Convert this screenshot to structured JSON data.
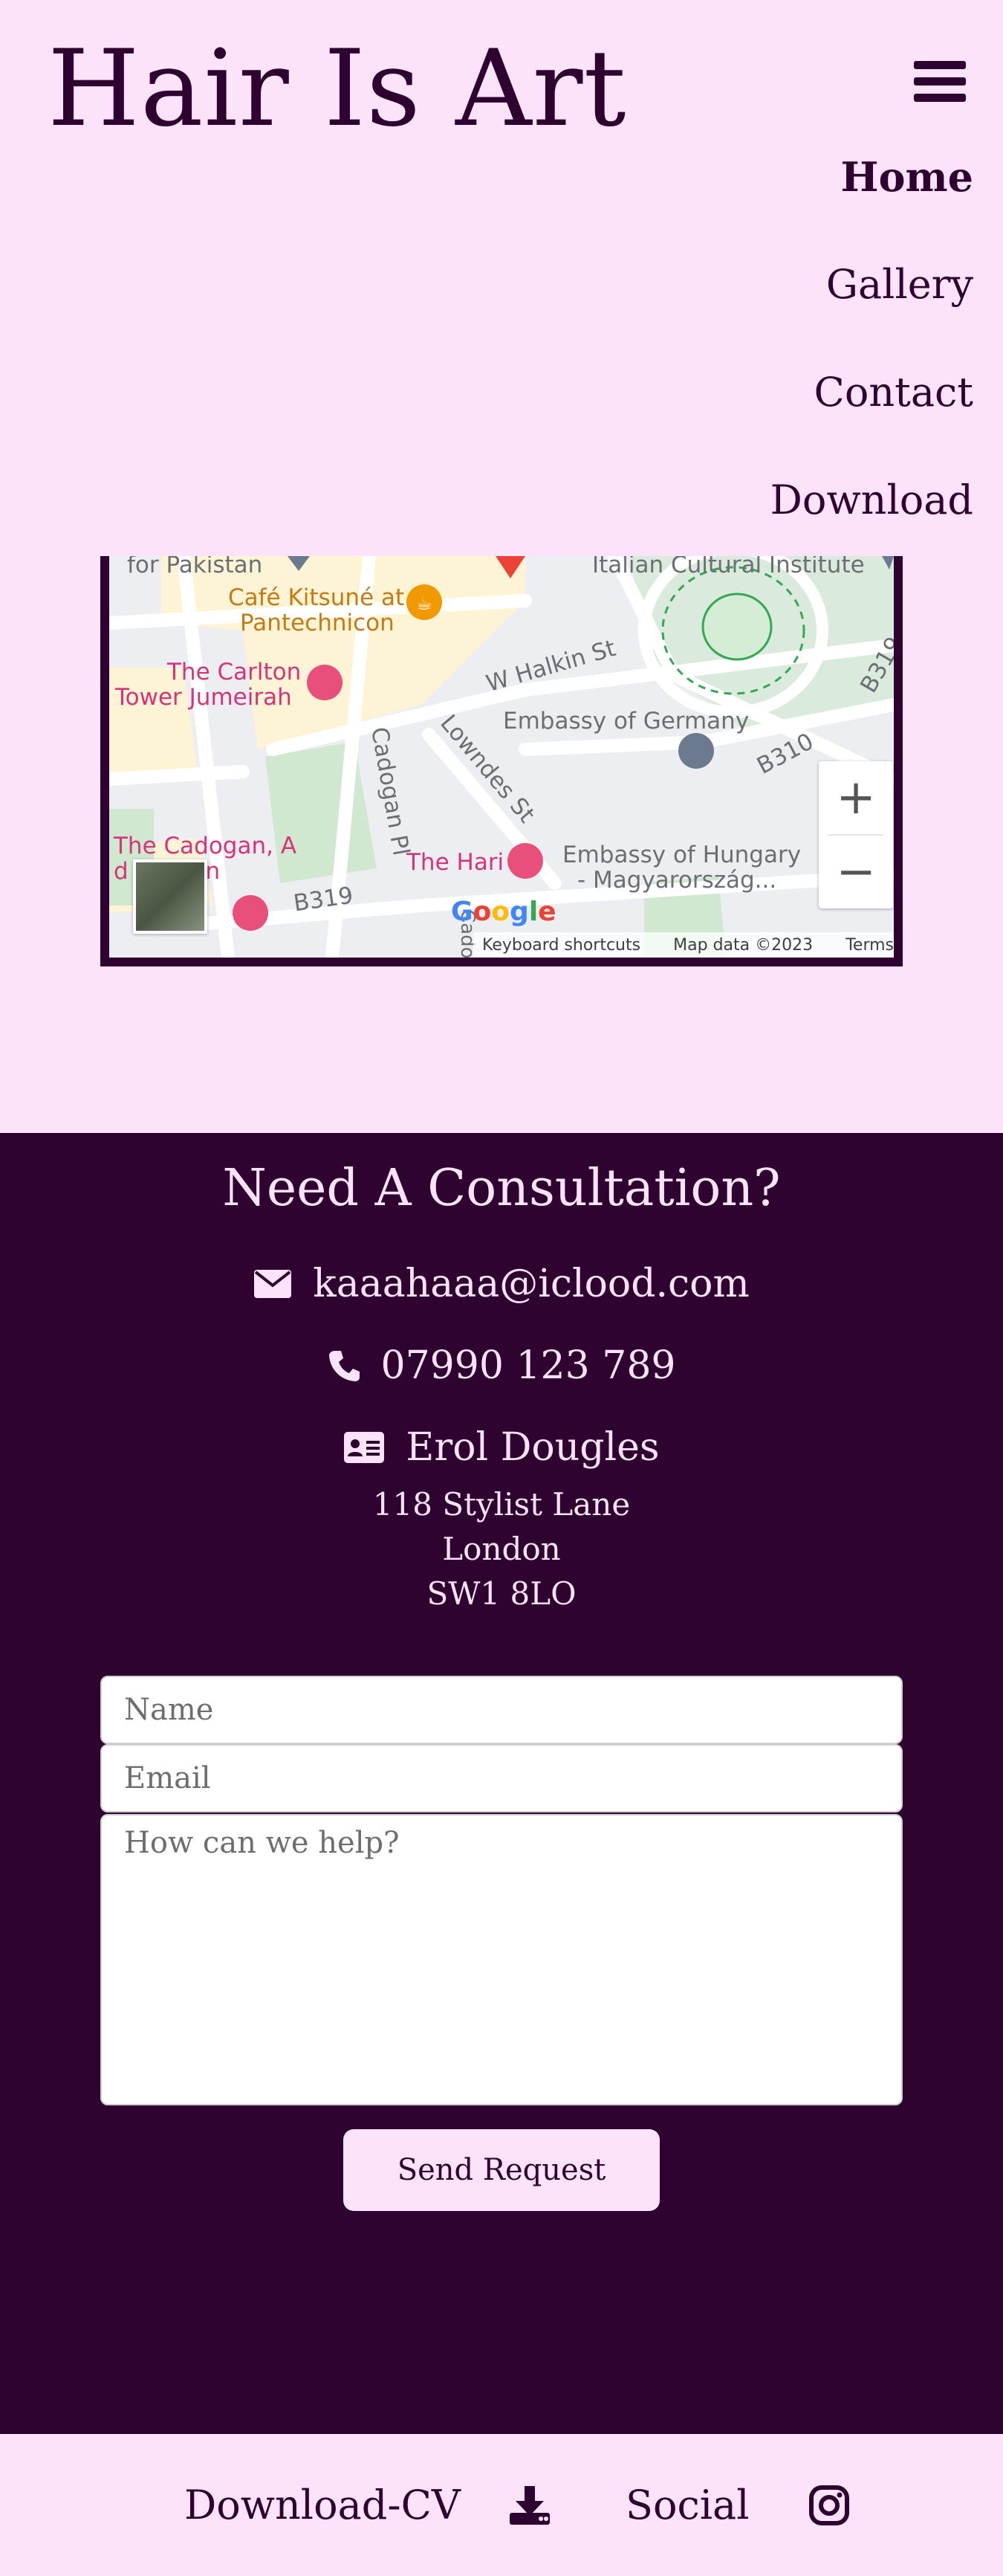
{
  "header": {
    "title": "Hair Is Art",
    "menu_icon": "bars-icon"
  },
  "nav": {
    "items": [
      {
        "label": "Home",
        "active": true
      },
      {
        "label": "Gallery",
        "active": false
      },
      {
        "label": "Contact",
        "active": false
      },
      {
        "label": "Download",
        "active": false
      }
    ]
  },
  "map": {
    "labels": {
      "pakistan": "for Pakistan",
      "italian": "Italian Cultural Institute",
      "cafe_1": "Café Kitsuné at",
      "cafe_2": "Pantechnicon",
      "carlton_1": "The Carlton",
      "carlton_2": "Tower Jumeirah",
      "halkin": "W Halkin St",
      "germany": "Embassy of Germany",
      "b310": "B310",
      "b319_right": "B319",
      "lowndes": "Lowndes St",
      "cadogan_pl": "Cadogan Pl",
      "cadogan_1": "The Cadogan, A",
      "cadogan_2": "d London",
      "b319_left": "B319",
      "hari": "The Hari",
      "hungary_1": "Embassy of Hungary",
      "hungary_2": "- Magyarország...",
      "cadog": "Cadog"
    },
    "zoom_in": "+",
    "zoom_out": "−",
    "footer": {
      "shortcuts": "Keyboard shortcuts",
      "data": "Map data ©2023",
      "terms": "Terms"
    }
  },
  "consultation": {
    "heading": "Need A Consultation?",
    "email": "kaaahaaa@iclood.com",
    "phone": "07990 123 789",
    "name": "Erol Dougles",
    "address": [
      "118 Stylist Lane",
      "London",
      "SW1 8LO"
    ],
    "form": {
      "name_placeholder": "Name",
      "email_placeholder": "Email",
      "message_placeholder": "How can we help?",
      "submit_label": "Send Request"
    }
  },
  "footer": {
    "download_label": "Download-CV",
    "social_label": "Social"
  },
  "colors": {
    "background": "#fde3fa",
    "accent_dark": "#2e0330"
  }
}
